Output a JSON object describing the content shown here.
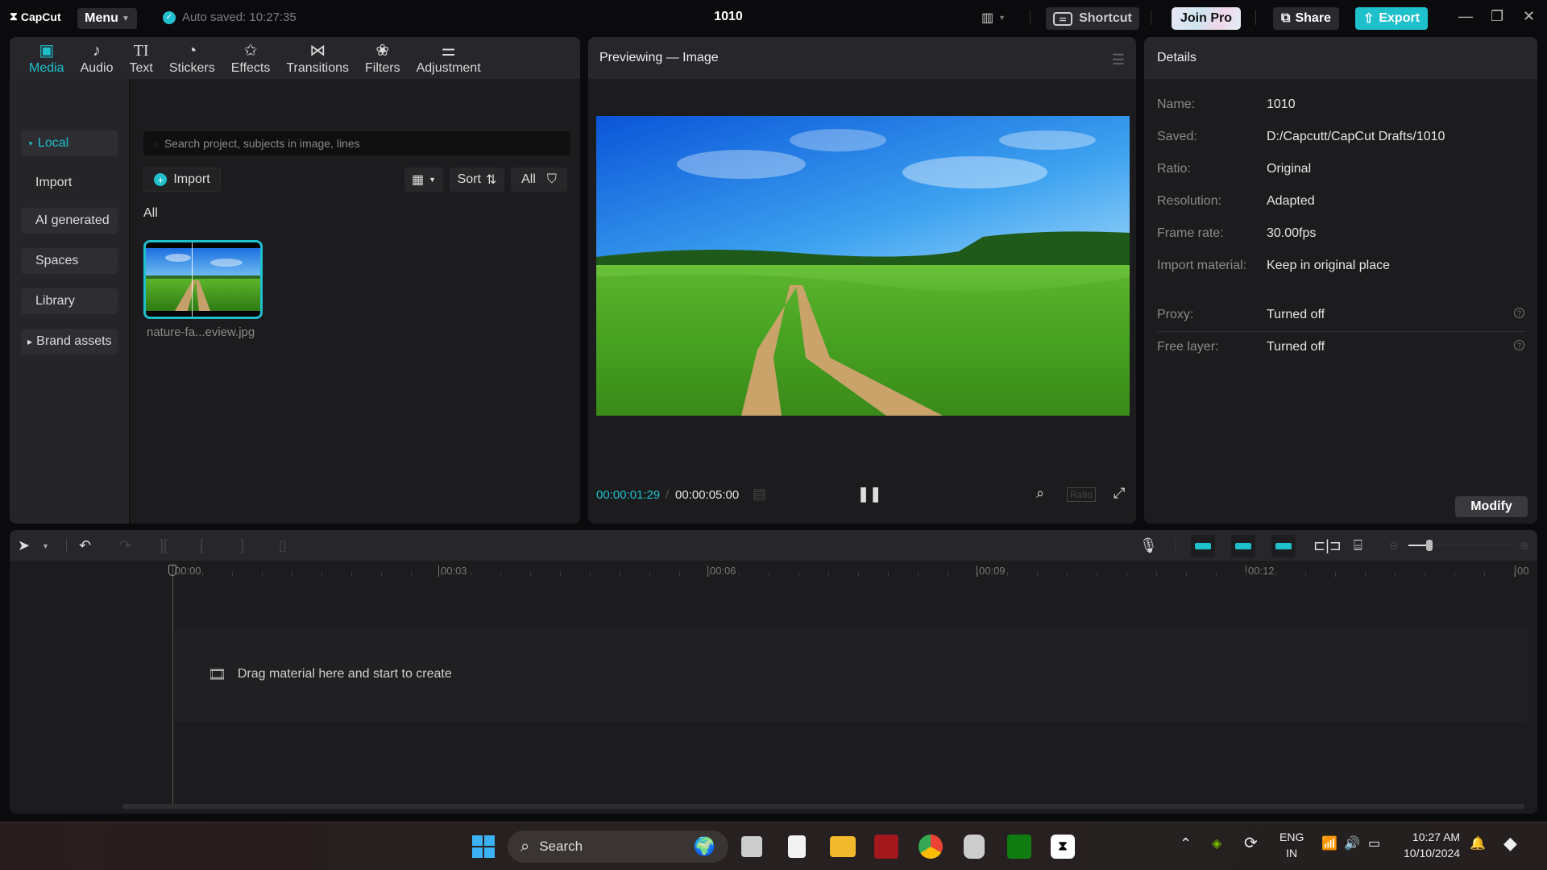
{
  "titlebar": {
    "app_name": "CapCut",
    "menu_label": "Menu",
    "autosave": "Auto saved: 10:27:35",
    "project_title": "1010",
    "shortcut_label": "Shortcut",
    "joinpro_label": "Join Pro",
    "share_label": "Share",
    "export_label": "Export",
    "accent": "#1ec0cc"
  },
  "toptabs": [
    {
      "label": "Media",
      "icon": "media-icon",
      "glyph": "▣",
      "active": true
    },
    {
      "label": "Audio",
      "icon": "audio-icon",
      "glyph": "♪"
    },
    {
      "label": "Text",
      "icon": "text-icon",
      "glyph": "TI"
    },
    {
      "label": "Stickers",
      "icon": "sticker-icon",
      "glyph": "◔"
    },
    {
      "label": "Effects",
      "icon": "effects-icon",
      "glyph": "✩"
    },
    {
      "label": "Transitions",
      "icon": "transitions-icon",
      "glyph": "⋈"
    },
    {
      "label": "Filters",
      "icon": "filters-icon",
      "glyph": "❀"
    },
    {
      "label": "Adjustment",
      "icon": "adjustment-icon",
      "glyph": "⚌"
    }
  ],
  "sidebar": {
    "items": [
      {
        "label": "Local",
        "expanded": true
      },
      {
        "label": "Import"
      },
      {
        "label": "AI generated"
      },
      {
        "label": "Spaces"
      },
      {
        "label": "Library"
      },
      {
        "label": "Brand assets",
        "collapsed": true
      }
    ]
  },
  "media": {
    "search_placeholder": "Search project, subjects in image, lines",
    "import_label": "Import",
    "sort_label": "Sort",
    "filter_label": "All",
    "section_label": "All",
    "items": [
      {
        "name": "nature-fa...eview.jpg"
      }
    ]
  },
  "preview": {
    "title": "Previewing — Image",
    "current_time": "00:00:01:29",
    "total_time": "00:00:05:00",
    "ratio_label": "Ratio"
  },
  "details": {
    "title": "Details",
    "rows": [
      {
        "key": "Name:",
        "value": "1010"
      },
      {
        "key": "Saved:",
        "value": "D:/Capcutt/CapCut Drafts/1010"
      },
      {
        "key": "Ratio:",
        "value": "Original"
      },
      {
        "key": "Resolution:",
        "value": "Adapted"
      },
      {
        "key": "Frame rate:",
        "value": "30.00fps"
      },
      {
        "key": "Import material:",
        "value": "Keep in original place"
      },
      {
        "key": "Proxy:",
        "value": "Turned off"
      },
      {
        "key": "Free layer:",
        "value": "Turned off"
      }
    ],
    "modify_label": "Modify"
  },
  "timeline": {
    "ruler_labels": [
      "00:00",
      "00:03",
      "00:06",
      "00:09",
      "00:12",
      "00"
    ],
    "drop_hint": "Drag material here and start to create",
    "zoom_level": 0.2
  },
  "taskbar": {
    "search_label": "Search",
    "language": "ENG",
    "region": "IN",
    "time": "10:27 AM",
    "date": "10/10/2024"
  }
}
